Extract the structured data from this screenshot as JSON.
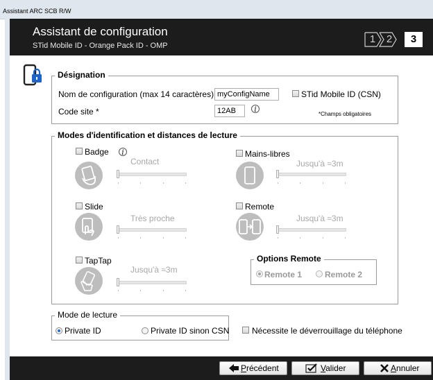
{
  "window": {
    "title": "Assistant ARC SCB R/W"
  },
  "banner": {
    "title": "Assistant de configuration",
    "subtitle": "STid Mobile ID - Orange Pack ID - OMP",
    "steps": [
      "1",
      "2",
      "3"
    ],
    "active_step": 3
  },
  "designation": {
    "legend": "Désignation",
    "config_name_label": "Nom de configuration (max 14 caractères) *",
    "config_name_value": "myConfigName",
    "csn_checkbox_label": "STid Mobile ID (CSN)",
    "site_code_label": "Code site *",
    "site_code_value": "12AB",
    "required_note": "*Champs obligatoires",
    "info_symbol": "i"
  },
  "modes": {
    "legend": "Modes d'identification et distances de lecture",
    "badge": {
      "label": "Badge",
      "distance": "Contact",
      "checked": false,
      "icon": "badge-hand-icon",
      "level": 0
    },
    "mains_libres": {
      "label": "Mains-libres",
      "distance": "Jusqu'à ≈3m",
      "checked": false,
      "icon": "phone-icon",
      "level": 0
    },
    "slide": {
      "label": "Slide",
      "distance": "Très proche",
      "checked": false,
      "icon": "slide-hand-icon",
      "level": 0
    },
    "remote": {
      "label": "Remote",
      "distance": "Jusqu'à ≈3m",
      "checked": false,
      "icon": "remote-phone-icon",
      "level": 0
    },
    "taptap": {
      "label": "TapTap",
      "distance": "Jusqu'à ≈3m",
      "checked": false,
      "icon": "taptap-hand-icon",
      "level": 0
    },
    "options_remote": {
      "legend": "Options Remote",
      "option1": "Remote 1",
      "option2": "Remote 2",
      "selected": "Remote 1"
    }
  },
  "reading_mode": {
    "legend": "Mode de lecture",
    "option1": "Private ID",
    "option2": "Private ID sinon CSN",
    "selected": "Private ID"
  },
  "unlock": {
    "label": "Nécessite le déverrouillage du téléphone",
    "checked": false
  },
  "buttons": {
    "previous": {
      "prefix": "",
      "mnemonic": "P",
      "rest": "récédent"
    },
    "validate": {
      "mnemonic": "V",
      "rest": "alider"
    },
    "cancel": {
      "mnemonic": "A",
      "rest": "nnuler"
    }
  },
  "colors": {
    "banner": "#1c1c1c",
    "accent": "#1e64c8",
    "disabled_text": "#a8a8a8"
  }
}
